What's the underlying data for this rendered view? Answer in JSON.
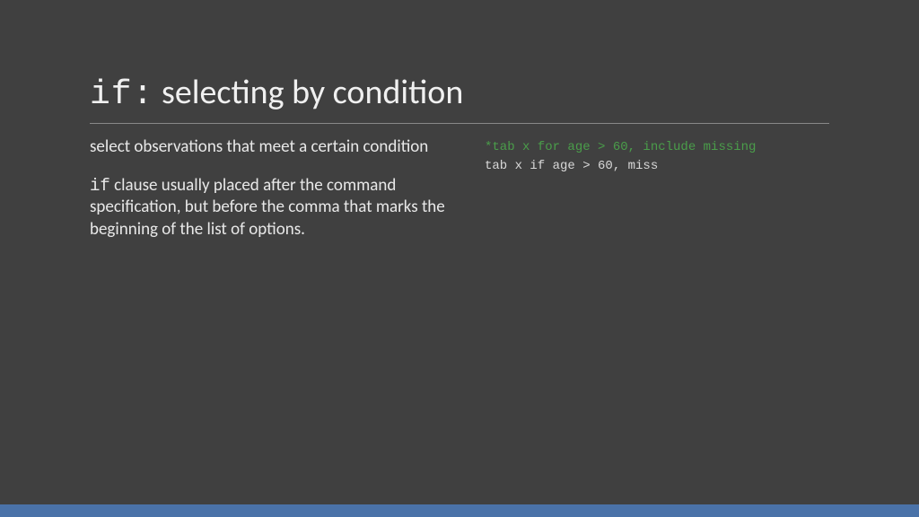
{
  "title": {
    "keyword": "if:",
    "rest": "  selecting by condition"
  },
  "left": {
    "para1": "select observations that meet a certain condition",
    "para2_keyword": "if",
    "para2_rest": " clause usually placed after the command specification, but before the comma that marks the beginning of the list of options."
  },
  "right": {
    "comment": "*tab x for age > 60, include missing",
    "code": "tab x if age > 60, miss"
  }
}
